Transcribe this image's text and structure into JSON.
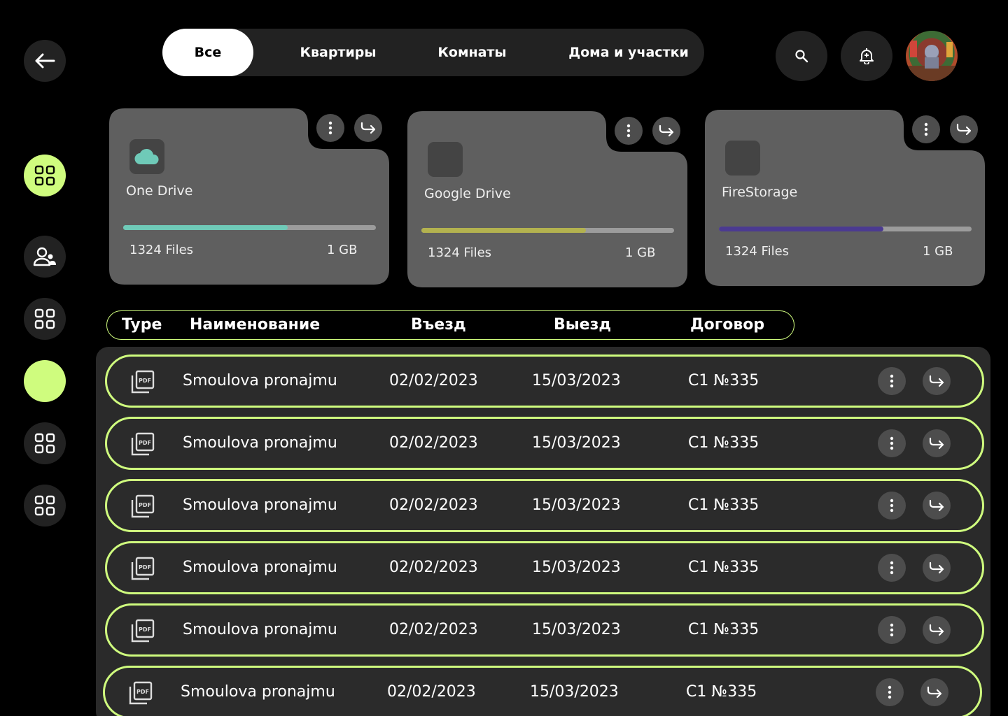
{
  "nav": {
    "tabs": [
      {
        "label": "Все",
        "active": true
      },
      {
        "label": "Квартиры",
        "active": false
      },
      {
        "label": "Комнаты",
        "active": false
      },
      {
        "label": "Дома и участки",
        "active": false
      }
    ]
  },
  "storages": [
    {
      "name": "One Drive",
      "files": "1324 Files",
      "size": "1 GB",
      "used_fraction": 0.65,
      "color": "#6fcab8",
      "icon": "cloud-icon"
    },
    {
      "name": "Google Drive",
      "files": "1324 Files",
      "size": "1 GB",
      "used_fraction": 0.65,
      "color": "#b3b24f",
      "icon": "google-drive-icon"
    },
    {
      "name": "FireStorage",
      "files": "1324 Files",
      "size": "1 GB",
      "used_fraction": 0.65,
      "color": "#4b3a91",
      "icon": "firestorage-icon"
    }
  ],
  "table": {
    "headers": {
      "type": "Type",
      "name": "Наименование",
      "checkin": "Въезд",
      "checkout": "Выезд",
      "contract": "Договор"
    },
    "rows": [
      {
        "name": "Smoulova pronajmu",
        "checkin": "02/02/2023",
        "checkout": "15/03/2023",
        "contract": "C1 №335",
        "type_icon": "pdf-icon"
      },
      {
        "name": "Smoulova pronajmu",
        "checkin": "02/02/2023",
        "checkout": "15/03/2023",
        "contract": "C1 №335",
        "type_icon": "pdf-icon"
      },
      {
        "name": "Smoulova pronajmu",
        "checkin": "02/02/2023",
        "checkout": "15/03/2023",
        "contract": "C1 №335",
        "type_icon": "pdf-icon"
      },
      {
        "name": "Smoulova pronajmu",
        "checkin": "02/02/2023",
        "checkout": "15/03/2023",
        "contract": "C1 №335",
        "type_icon": "pdf-icon"
      },
      {
        "name": "Smoulova pronajmu",
        "checkin": "02/02/2023",
        "checkout": "15/03/2023",
        "contract": "C1 №335",
        "type_icon": "pdf-icon"
      },
      {
        "name": "Smoulova pronajmu",
        "checkin": "02/02/2023",
        "checkout": "15/03/2023",
        "contract": "C1 №335",
        "type_icon": "pdf-icon"
      }
    ]
  },
  "colors": {
    "accent": "#cffc7e",
    "surface": "#222222",
    "card": "#5f5f5f"
  }
}
